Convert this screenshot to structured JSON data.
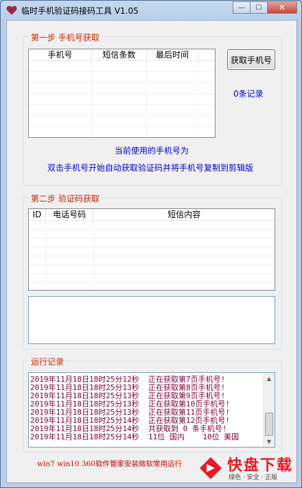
{
  "window": {
    "title": "临时手机验证码接码工具 V1.05",
    "minimize_glyph": "—",
    "maximize_glyph": "☐",
    "close_glyph": "✕"
  },
  "step1": {
    "group_title": "第一步  手机号获取",
    "columns": [
      "手机号",
      "短信条数",
      "最后时间"
    ],
    "get_button": "获取手机号",
    "record_count": "0条记录",
    "current_phone_label": "当前使用的手机号为",
    "hint": "双击手机号开始自动获取验证码并将手机号复制到剪辑版"
  },
  "step2": {
    "group_title": "第二步  验证码获取",
    "columns": [
      "ID",
      "电话号码",
      "短信内容"
    ]
  },
  "log": {
    "group_title": "运行记录",
    "lines": [
      "2019年11月18日18时25分12秒  正在获取第7页手机号!",
      "2019年11月18日18时25分13秒  正在获取第8页手机号!",
      "2019年11月18日18时25分13秒  正在获取第9页手机号!",
      "2019年11月18日18时25分13秒  正在获取第10页手机号!",
      "2019年11月18日18时25分13秒  正在获取第11页手机号!",
      "2019年11月18日18时25分14秒  正在获取第12页手机号!",
      "2019年11月18日18时25分14秒  共获取到 0 条手机号!",
      "2019年11月18日18时25分14秒  11位 国内    10位 美国"
    ],
    "scroll_up": "▲",
    "scroll_down": "▼"
  },
  "footer": {
    "text": "win7 win10 360软件管家安装微软常用运行"
  },
  "watermark": {
    "logo_text": "快盘下载",
    "tagline": "绿色 · 安全 · 正版"
  },
  "colors": {
    "group_title": "#cc2200",
    "blue_text": "#0000cc",
    "log_text": "#80003a",
    "footer_text": "#cc0000",
    "watermark": "#e21b24"
  }
}
